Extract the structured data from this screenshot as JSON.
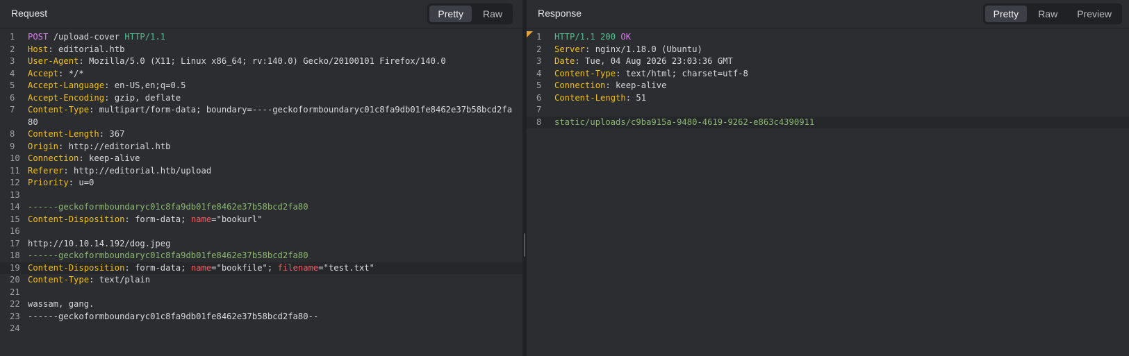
{
  "request": {
    "title": "Request",
    "tabs": [
      "Pretty",
      "Raw"
    ],
    "active_tab": "Pretty",
    "lines": [
      {
        "n": "1",
        "segs": [
          {
            "t": "POST",
            "c": "method"
          },
          {
            "t": " /upload-cover ",
            "c": ""
          },
          {
            "t": "HTTP/1.1",
            "c": "proto"
          }
        ]
      },
      {
        "n": "2",
        "segs": [
          {
            "t": "Host",
            "c": "key"
          },
          {
            "t": ": editorial.htb",
            "c": ""
          }
        ]
      },
      {
        "n": "3",
        "segs": [
          {
            "t": "User-Agent",
            "c": "key"
          },
          {
            "t": ": Mozilla/5.0 (X11; Linux x86_64; rv:140.0) Gecko/20100101 Firefox/140.0",
            "c": ""
          }
        ]
      },
      {
        "n": "4",
        "segs": [
          {
            "t": "Accept",
            "c": "key"
          },
          {
            "t": ": */*",
            "c": ""
          }
        ]
      },
      {
        "n": "5",
        "segs": [
          {
            "t": "Accept-Language",
            "c": "key"
          },
          {
            "t": ": en-US,en;q=0.5",
            "c": ""
          }
        ]
      },
      {
        "n": "6",
        "segs": [
          {
            "t": "Accept-Encoding",
            "c": "key"
          },
          {
            "t": ": gzip, deflate",
            "c": ""
          }
        ]
      },
      {
        "n": "7",
        "segs": [
          {
            "t": "Content-Type",
            "c": "key"
          },
          {
            "t": ": multipart/form-data; boundary=----geckoformboundaryc01c8fa9db01fe8462e37b58bcd2fa80",
            "c": ""
          }
        ]
      },
      {
        "n": "8",
        "segs": [
          {
            "t": "Content-Length",
            "c": "key"
          },
          {
            "t": ": 367",
            "c": ""
          }
        ]
      },
      {
        "n": "9",
        "segs": [
          {
            "t": "Origin",
            "c": "key"
          },
          {
            "t": ": http://editorial.htb",
            "c": ""
          }
        ]
      },
      {
        "n": "10",
        "segs": [
          {
            "t": "Connection",
            "c": "key"
          },
          {
            "t": ": keep-alive",
            "c": ""
          }
        ]
      },
      {
        "n": "11",
        "segs": [
          {
            "t": "Referer",
            "c": "key"
          },
          {
            "t": ": http://editorial.htb/upload",
            "c": ""
          }
        ]
      },
      {
        "n": "12",
        "segs": [
          {
            "t": "Priority",
            "c": "key"
          },
          {
            "t": ": u=0",
            "c": ""
          }
        ]
      },
      {
        "n": "13",
        "segs": []
      },
      {
        "n": "14",
        "segs": [
          {
            "t": "------geckoformboundaryc01c8fa9db01fe8462e37b58bcd2fa80",
            "c": "bound"
          }
        ]
      },
      {
        "n": "15",
        "segs": [
          {
            "t": "Content-Disposition",
            "c": "key"
          },
          {
            "t": ": form-data; ",
            "c": ""
          },
          {
            "t": "name",
            "c": "attr"
          },
          {
            "t": "=\"bookurl\"",
            "c": ""
          }
        ]
      },
      {
        "n": "16",
        "segs": []
      },
      {
        "n": "17",
        "segs": [
          {
            "t": "http://10.10.14.192/dog.jpeg",
            "c": ""
          }
        ]
      },
      {
        "n": "18",
        "segs": [
          {
            "t": "------geckoformboundaryc01c8fa9db01fe8462e37b58bcd2fa80",
            "c": "bound"
          }
        ]
      },
      {
        "n": "19",
        "hl": true,
        "segs": [
          {
            "t": "Content-Disposition",
            "c": "key"
          },
          {
            "t": ": form-data; ",
            "c": ""
          },
          {
            "t": "name",
            "c": "attr"
          },
          {
            "t": "=\"bookfile\"; ",
            "c": ""
          },
          {
            "t": "filename",
            "c": "attr"
          },
          {
            "t": "=\"test.txt\"",
            "c": ""
          }
        ]
      },
      {
        "n": "20",
        "segs": [
          {
            "t": "Content-Type",
            "c": "key"
          },
          {
            "t": ": text/plain",
            "c": ""
          }
        ]
      },
      {
        "n": "21",
        "segs": []
      },
      {
        "n": "22",
        "segs": [
          {
            "t": "wassam, gang.",
            "c": ""
          }
        ]
      },
      {
        "n": "23",
        "segs": [
          {
            "t": "------geckoformboundaryc01c8fa9db01fe8462e37b58bcd2fa80--",
            "c": ""
          }
        ]
      },
      {
        "n": "24",
        "segs": []
      }
    ]
  },
  "response": {
    "title": "Response",
    "tabs": [
      "Pretty",
      "Raw",
      "Preview"
    ],
    "active_tab": "Pretty",
    "lines": [
      {
        "n": "1",
        "segs": [
          {
            "t": "HTTP/1.1",
            "c": "proto"
          },
          {
            "t": " 200 ",
            "c": "proto"
          },
          {
            "t": "OK",
            "c": "status"
          }
        ]
      },
      {
        "n": "2",
        "segs": [
          {
            "t": "Server",
            "c": "key"
          },
          {
            "t": ": nginx/1.18.0 (Ubuntu)",
            "c": ""
          }
        ]
      },
      {
        "n": "3",
        "segs": [
          {
            "t": "Date",
            "c": "key"
          },
          {
            "t": ": Tue, 04 Aug 2026 23:03:36 GMT",
            "c": ""
          }
        ]
      },
      {
        "n": "4",
        "segs": [
          {
            "t": "Content-Type",
            "c": "key"
          },
          {
            "t": ": text/html; charset=utf-8",
            "c": ""
          }
        ]
      },
      {
        "n": "5",
        "segs": [
          {
            "t": "Connection",
            "c": "key"
          },
          {
            "t": ": keep-alive",
            "c": ""
          }
        ]
      },
      {
        "n": "6",
        "segs": [
          {
            "t": "Content-Length",
            "c": "key"
          },
          {
            "t": ": 51",
            "c": ""
          }
        ]
      },
      {
        "n": "7",
        "segs": []
      },
      {
        "n": "8",
        "hl": true,
        "segs": [
          {
            "t": "static/uploads/c9ba915a-9480-4619-9262-e863c4390911",
            "c": "body-green"
          }
        ]
      }
    ]
  },
  "colors": {
    "background": "#2b2d31",
    "header_key": "#f2c014",
    "method": "#d67ee8",
    "protocol": "#4fc28f",
    "boundary": "#8bb870",
    "attribute": "#ee5e5e",
    "warning_marker": "#e8a33c"
  }
}
